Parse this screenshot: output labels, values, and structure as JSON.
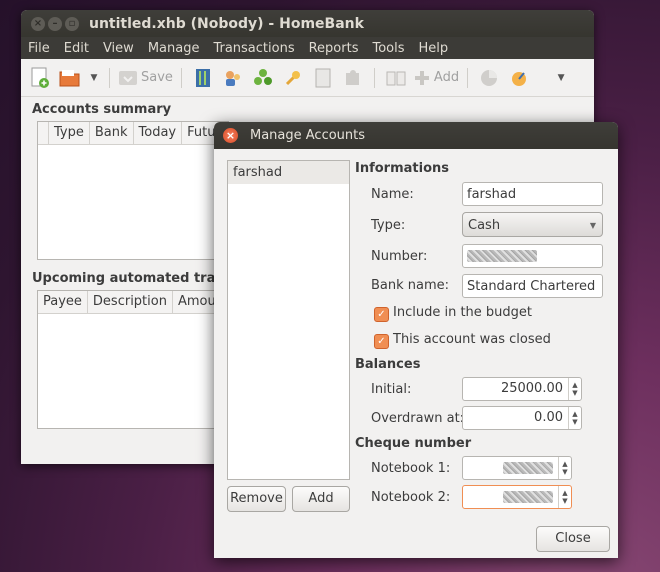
{
  "main_window": {
    "title": "untitled.xhb (Nobody) - HomeBank",
    "menu": [
      "File",
      "Edit",
      "View",
      "Manage",
      "Transactions",
      "Reports",
      "Tools",
      "Help"
    ],
    "toolbar": {
      "save_label": "Save",
      "add_label": "Add"
    },
    "accounts_summary": {
      "title": "Accounts summary",
      "columns": [
        "Type",
        "Bank",
        "Today",
        "Future"
      ]
    },
    "upcoming": {
      "title": "Upcoming automated transa",
      "columns": [
        "Payee",
        "Description",
        "Amount"
      ]
    }
  },
  "dialog": {
    "title": "Manage Accounts",
    "accounts": [
      "farshad"
    ],
    "remove_label": "Remove",
    "add_label": "Add",
    "close_label": "Close",
    "informations": {
      "heading": "Informations",
      "name_label": "Name:",
      "name_value": "farshad",
      "type_label": "Type:",
      "type_value": "Cash",
      "number_label": "Number:",
      "bank_label": "Bank name:",
      "bank_value": "Standard Chartered",
      "budget_label": "Include in the budget",
      "closed_label": "This account was closed"
    },
    "balances": {
      "heading": "Balances",
      "initial_label": "Initial:",
      "initial_value": "25000.00",
      "overdrawn_label": "Overdrawn at:",
      "overdrawn_value": "0.00"
    },
    "cheque": {
      "heading": "Cheque number",
      "nb1_label": "Notebook 1:",
      "nb2_label": "Notebook 2:"
    }
  }
}
